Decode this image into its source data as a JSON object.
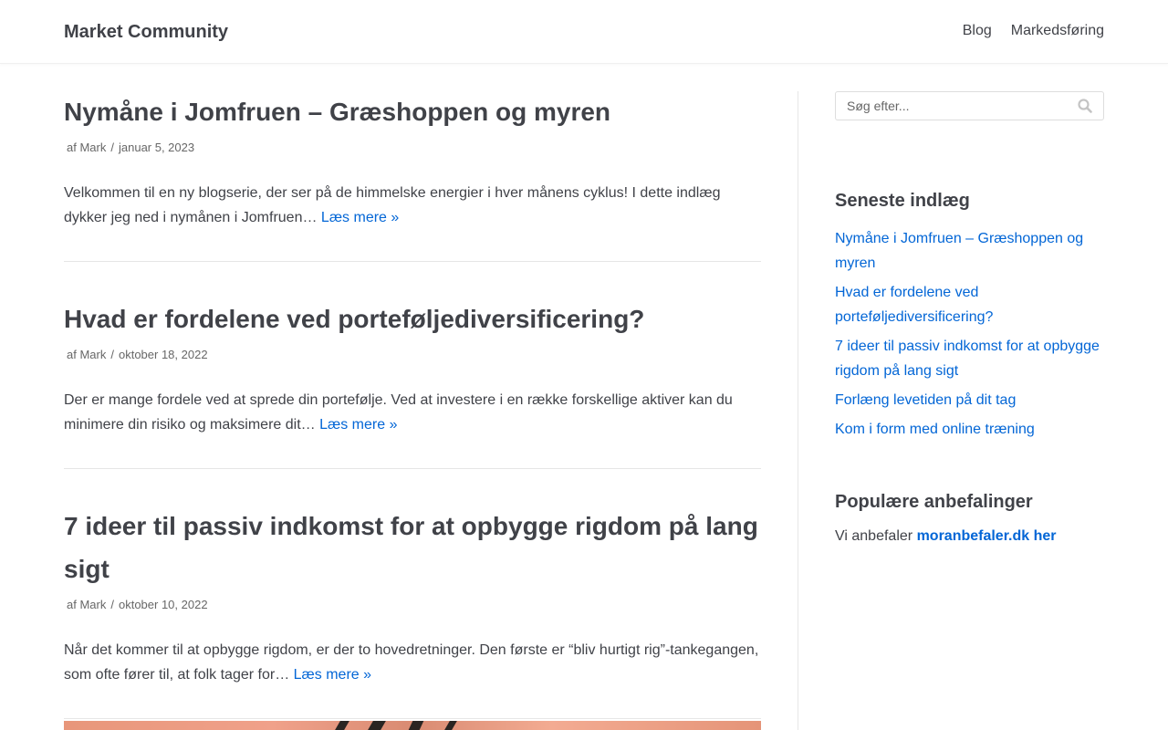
{
  "site": {
    "title": "Market Community"
  },
  "nav": [
    {
      "label": "Blog"
    },
    {
      "label": "Markedsføring"
    }
  ],
  "posts": [
    {
      "title": "Nymåne i Jomfruen – Græshoppen og myren",
      "author_prefix": "af",
      "author": "Mark",
      "separator": "/",
      "date": "januar 5, 2023",
      "excerpt": "Velkommen til en ny blogserie, der ser på de himmelske energier i hver månens cyklus! I dette indlæg dykker jeg ned i nymånen i Jomfruen…",
      "read_more": "Læs mere »"
    },
    {
      "title": "Hvad er fordelene ved porteføljediversificering?",
      "author_prefix": "af",
      "author": "Mark",
      "separator": "/",
      "date": "oktober 18, 2022",
      "excerpt": "Der er mange fordele ved at sprede din portefølje. Ved at investere i en række forskellige aktiver kan du minimere din risiko og maksimere dit…",
      "read_more": "Læs mere »"
    },
    {
      "title": "7 ideer til passiv indkomst for at opbygge rigdom på lang sigt",
      "author_prefix": "af",
      "author": "Mark",
      "separator": "/",
      "date": "oktober 10, 2022",
      "excerpt": "Når det kommer til at opbygge rigdom, er der to hovedretninger. Den første er “bliv hurtigt rig”-tankegangen, som ofte fører til, at folk tager for…",
      "read_more": "Læs mere »"
    }
  ],
  "sidebar": {
    "search": {
      "placeholder": "Søg efter...",
      "icon": "search-icon"
    },
    "recent": {
      "title": "Seneste indlæg",
      "items": [
        "Nymåne i Jomfruen – Græshoppen og myren",
        "Hvad er fordelene ved porteføljediversificering?",
        "7 ideer til passiv indkomst for at opbygge rigdom på lang sigt",
        "Forlæng levetiden på dit tag",
        "Kom i form med online træning"
      ]
    },
    "popular": {
      "title": "Populære anbefalinger",
      "text": "Vi anbefaler",
      "link": "moranbefaler.dk her"
    }
  },
  "colors": {
    "link": "#0366d6",
    "text": "#404248",
    "meta": "#676767"
  }
}
